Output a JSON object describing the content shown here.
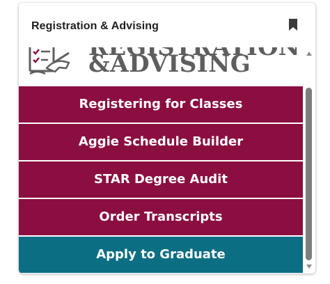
{
  "widget": {
    "title": "Registration & Advising",
    "bookmark_icon": "bookmark-icon"
  },
  "banner": {
    "heading": "REGISTRATION",
    "subheading": "&ADVISING",
    "icon": "document-pen-icon"
  },
  "links": [
    {
      "label": "Registering for Classes",
      "color": "#8b0e41"
    },
    {
      "label": "Aggie Schedule Builder",
      "color": "#8b0e41"
    },
    {
      "label": "STAR Degree Audit",
      "color": "#8b0e41"
    },
    {
      "label": "Order Transcripts",
      "color": "#8b0e41"
    },
    {
      "label": "Apply to Graduate",
      "color": "#0c6e83"
    }
  ],
  "colors": {
    "maroon": "#8b0e41",
    "teal": "#0c6e83",
    "banner_text": "#5e5e5e"
  }
}
